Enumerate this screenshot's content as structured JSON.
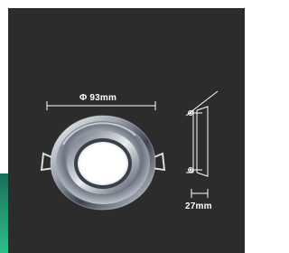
{
  "product": {
    "diameter_label": "Φ 93mm",
    "depth_label": "27mm"
  },
  "colors": {
    "panel_background": "#2c2c2c",
    "accent_green": "#2fbf8a",
    "drawing_lines": "#ffffff",
    "chrome_light": "#e6e9ee",
    "chrome_dark": "#2a3038"
  },
  "icons": {
    "diameter_symbol": "diameter-icon"
  }
}
